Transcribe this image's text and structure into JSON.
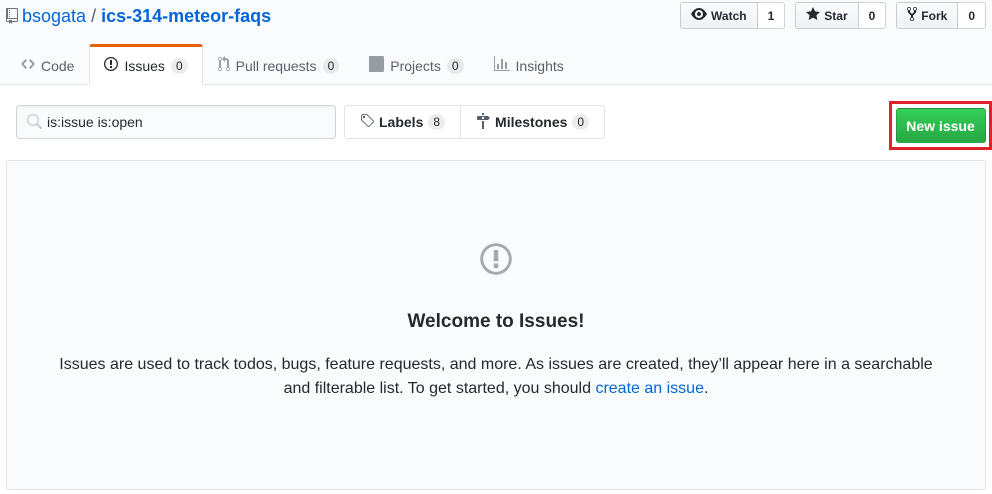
{
  "repo": {
    "owner": "bsogata",
    "separator": "/",
    "name": "ics-314-meteor-faqs"
  },
  "actions": {
    "watch": {
      "label": "Watch",
      "count": "1"
    },
    "star": {
      "label": "Star",
      "count": "0"
    },
    "fork": {
      "label": "Fork",
      "count": "0"
    }
  },
  "tabs": [
    {
      "label": "Code",
      "icon": "code-icon",
      "count": null
    },
    {
      "label": "Issues",
      "icon": "issue-opened-icon",
      "count": "0",
      "selected": true
    },
    {
      "label": "Pull requests",
      "icon": "git-pull-request-icon",
      "count": "0"
    },
    {
      "label": "Projects",
      "icon": "project-icon",
      "count": "0"
    },
    {
      "label": "Insights",
      "icon": "graph-icon",
      "count": null
    }
  ],
  "filters": {
    "search_value": "is:issue is:open",
    "labels": {
      "label": "Labels",
      "count": "8"
    },
    "milestones": {
      "label": "Milestones",
      "count": "0"
    },
    "new_issue_label": "New issue"
  },
  "blankslate": {
    "title": "Welcome to Issues!",
    "text_before": "Issues are used to track todos, bugs, feature requests, and more. As issues are created, they’ll appear here in a searchable and filterable list. To get started, you should ",
    "link_text": "create an issue",
    "text_after": "."
  },
  "colors": {
    "accent_link": "#0366d6",
    "tab_underline": "#e36209",
    "primary_button": "#28a745",
    "highlight_box": "#e0202b"
  }
}
